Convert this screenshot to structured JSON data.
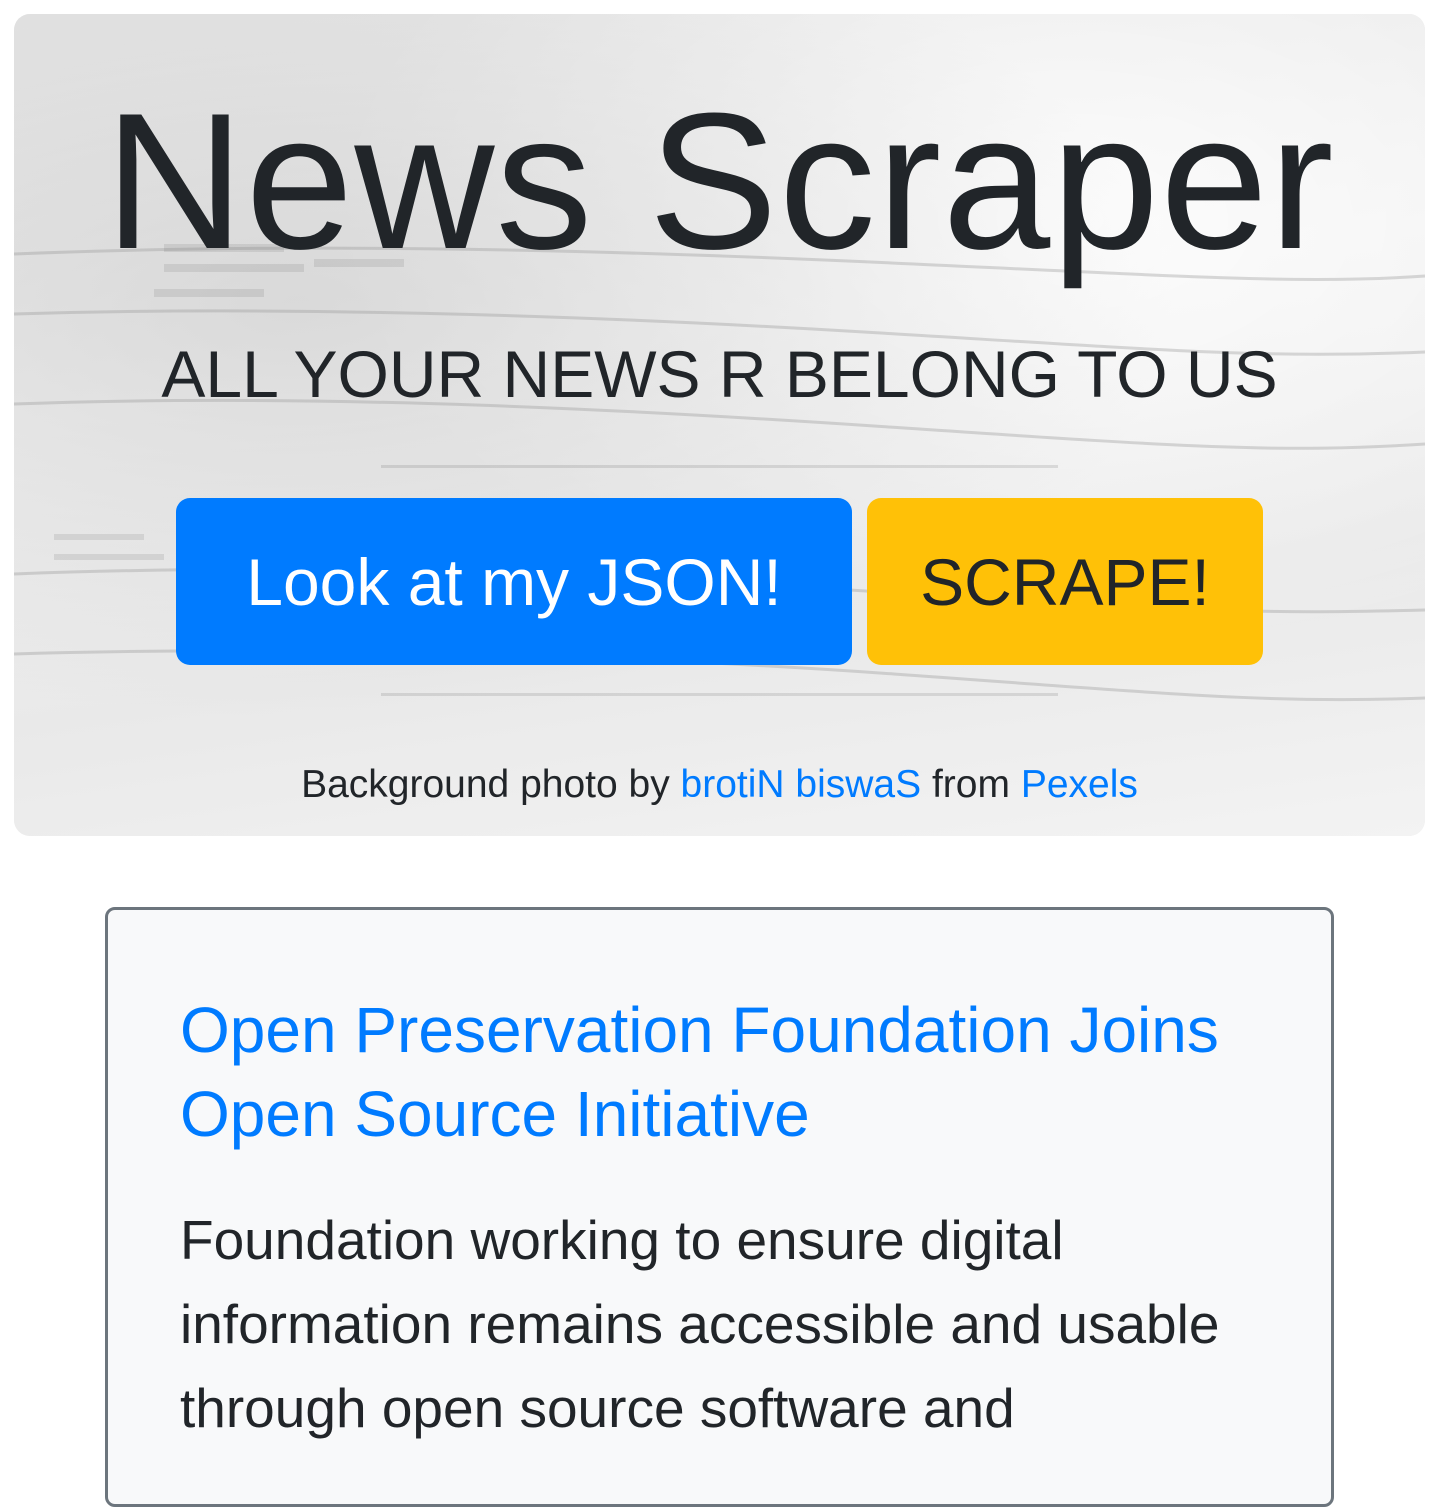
{
  "hero": {
    "title": "News Scraper",
    "subtitle": "ALL YOUR NEWS R BELONG TO US",
    "json_button_label": "Look at my JSON!",
    "scrape_button_label": "SCRAPE!",
    "credit_prefix": "Background photo by ",
    "credit_author": "brotiN biswaS",
    "credit_middle": " from ",
    "credit_source": "Pexels"
  },
  "article": {
    "title": "Open Preservation Foundation Joins Open Source Initiative",
    "summary": "Foundation working to ensure digital information remains accessible and usable through open source software and"
  },
  "colors": {
    "primary": "#007bff",
    "warning": "#ffc107",
    "text": "#212529",
    "card_border": "#6c757d",
    "card_bg": "#f8f9fa"
  }
}
